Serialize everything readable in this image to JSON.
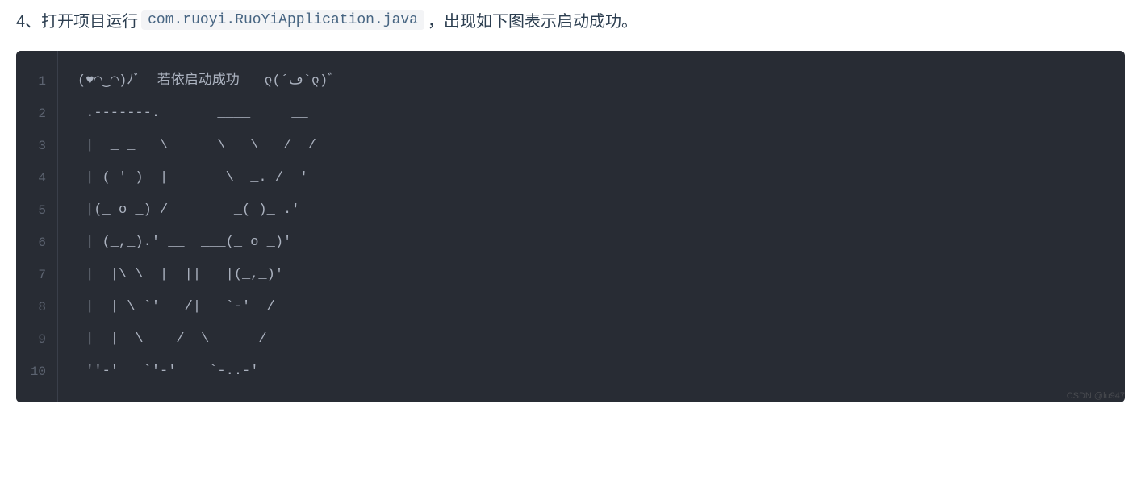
{
  "instruction": {
    "prefix": "4、打开项目运行",
    "code": "com.ruoyi.RuoYiApplication.java",
    "suffix": "，出现如下图表示启动成功。"
  },
  "code_block": {
    "line_numbers": [
      "1",
      "2",
      "3",
      "4",
      "5",
      "6",
      "7",
      "8",
      "9",
      "10"
    ],
    "lines": [
      "(♥◠‿◠)ﾉﾞ  若依启动成功   ლ(´ڡ`ლ)ﾞ  ",
      " .-------.       ____     __        ",
      " |  _ _   \\      \\   \\   /  /    ",
      " | ( ' )  |       \\  _. /  '       ",
      " |(_ o _) /        _( )_ .'         ",
      " | (_,_).' __  ___(_ o _)'          ",
      " |  |\\ \\  |  ||   |(_,_)'         ",
      " |  | \\ `'   /|   `-'  /           ",
      " |  |  \\    /  \\      /           ",
      " ''-'   `'-'    `-..-'              "
    ]
  },
  "watermark": "CSDN @lu947"
}
